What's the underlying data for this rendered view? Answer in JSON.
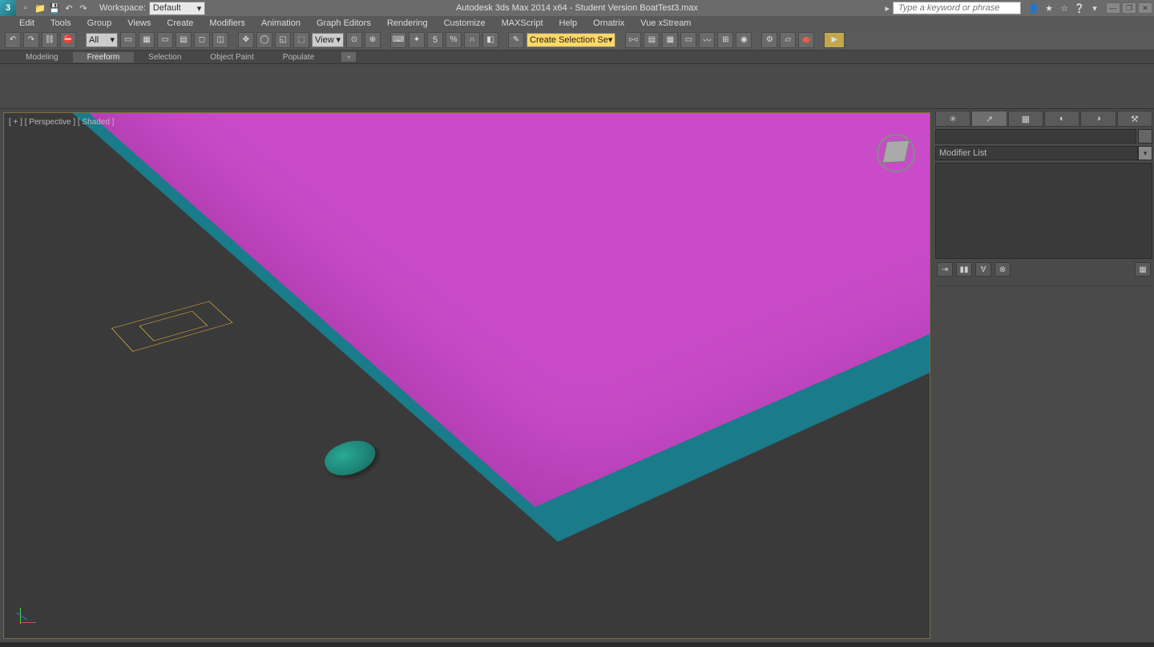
{
  "title": "Autodesk 3ds Max 2014 x64  - Student Version   BoatTest3.max",
  "workspace": {
    "label": "Workspace:",
    "value": "Default"
  },
  "search": {
    "placeholder": "Type a keyword or phrase"
  },
  "menu": [
    "Edit",
    "Tools",
    "Group",
    "Views",
    "Create",
    "Modifiers",
    "Animation",
    "Graph Editors",
    "Rendering",
    "Customize",
    "MAXScript",
    "Help",
    "Ornatrix",
    "Vue xStream"
  ],
  "ribbonTabs": [
    "Modeling",
    "Freeform",
    "Selection",
    "Object Paint",
    "Populate"
  ],
  "ribbonActive": 1,
  "toolbar": {
    "filterDropdown": "All",
    "coordDropdown": "View",
    "selSetDropdown": "Create Selection Se",
    "angleSnap": "5"
  },
  "viewport": {
    "label": "[ + ] [ Perspective ] [ Shaded ]"
  },
  "cmdPanel": {
    "tabs": [
      "✳",
      "↗",
      "▦",
      "◐",
      "◑",
      "⚒"
    ],
    "modifierListLabel": "Modifier List",
    "stackButtons": [
      "⇥",
      "▮▮",
      "∀",
      "⊗",
      "▦"
    ]
  }
}
